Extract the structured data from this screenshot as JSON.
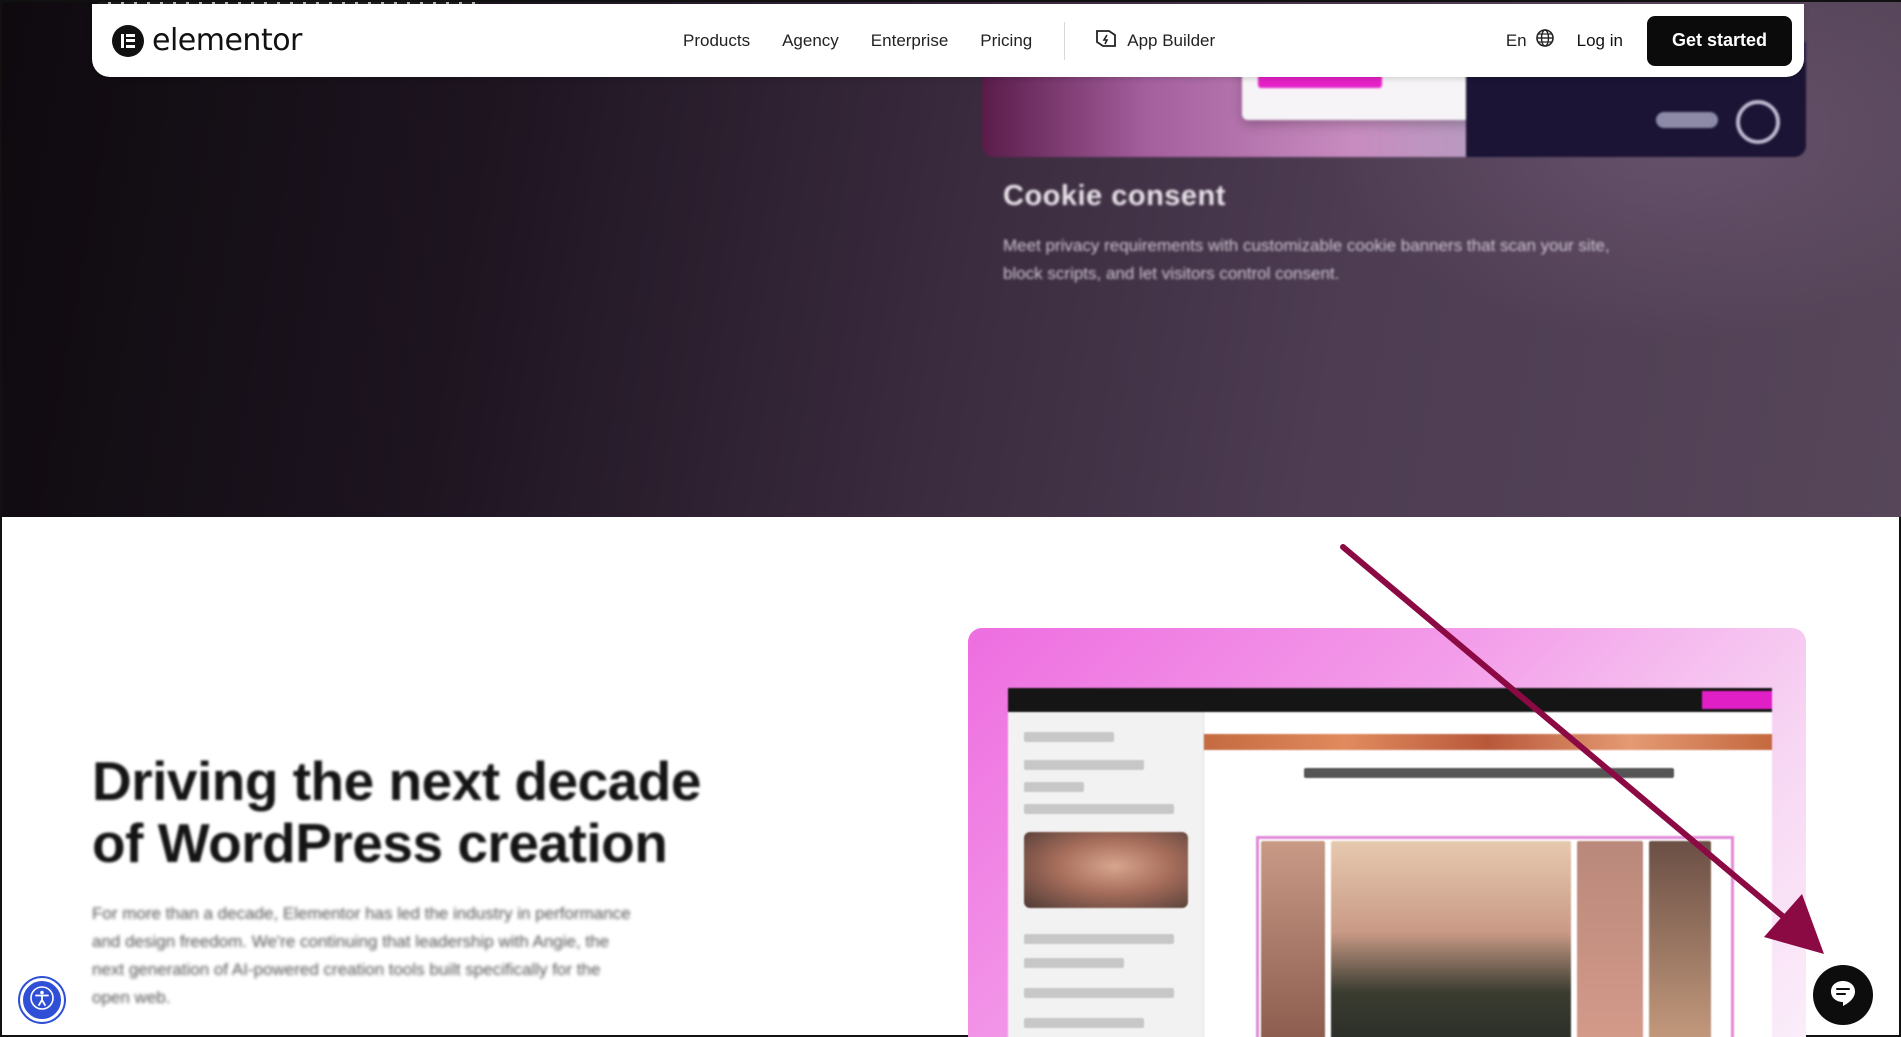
{
  "navbar": {
    "logo_text": "elementor",
    "links": [
      "Products",
      "Agency",
      "Enterprise",
      "Pricing"
    ],
    "app_builder_label": "App Builder",
    "language_label": "En",
    "login_label": "Log in",
    "cta_label": "Get started"
  },
  "cookie_section": {
    "title": "Cookie consent",
    "description": "Meet privacy requirements with customizable cookie banners that scan your site, block scripts, and let visitors control consent."
  },
  "feature_section": {
    "heading": "Driving the next decade of WordPress creation",
    "body": "For more than a decade, Elementor has led the industry in performance and design freedom. We're continuing that leadership with Angie, the next generation of AI-powered creation tools built specifically for the open web."
  },
  "colors": {
    "annotation_arrow": "#8b0a43",
    "accessibility_button": "#2f4fd6",
    "cta_background": "#0b0b0b",
    "editor_accent": "#e11fc7"
  },
  "icons": {
    "logo": "elementor-logo-icon",
    "app_builder": "app-builder-icon",
    "globe": "globe-icon",
    "accessibility": "accessibility-icon",
    "chat": "chat-icon"
  }
}
